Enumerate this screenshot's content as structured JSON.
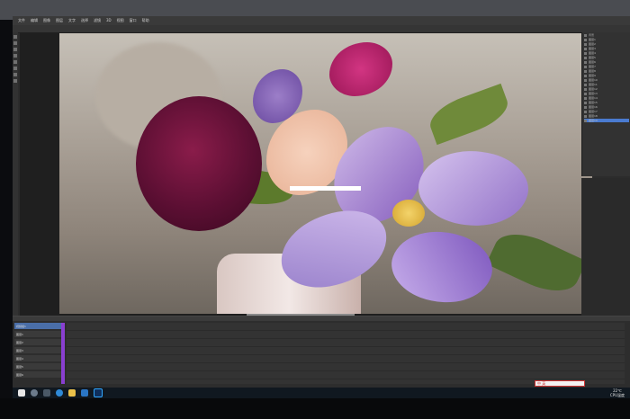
{
  "menu": [
    "文件",
    "编辑",
    "图像",
    "图层",
    "文字",
    "选择",
    "滤镜",
    "3D",
    "视图",
    "窗口",
    "帮助"
  ],
  "layers_panel": {
    "rows": [
      "背景",
      "图层1",
      "图层2",
      "图层3",
      "图层4",
      "图层5",
      "图层6",
      "图层7",
      "图层8",
      "图层9",
      "图层10",
      "图层11",
      "图层12",
      "图层13",
      "图层14",
      "图层15",
      "图层16",
      "图层17",
      "图层18",
      "图层19"
    ],
    "selected_index": 19
  },
  "timeline": {
    "rows": [
      "视频组1",
      "图层1",
      "图层2",
      "图层3",
      "图层4",
      "图层5",
      "图层6"
    ]
  },
  "taskbar": {
    "ime_text": "中 英",
    "tray_top": "22℃",
    "tray_bottom": "CPU温度"
  },
  "colors": {
    "accent": "#4a7bd0",
    "track": "#8a3fd1"
  },
  "icons": [
    "windows-start-icon",
    "search-icon",
    "task-view-icon",
    "browser-icon",
    "file-explorer-icon",
    "store-icon",
    "photoshop-icon"
  ]
}
